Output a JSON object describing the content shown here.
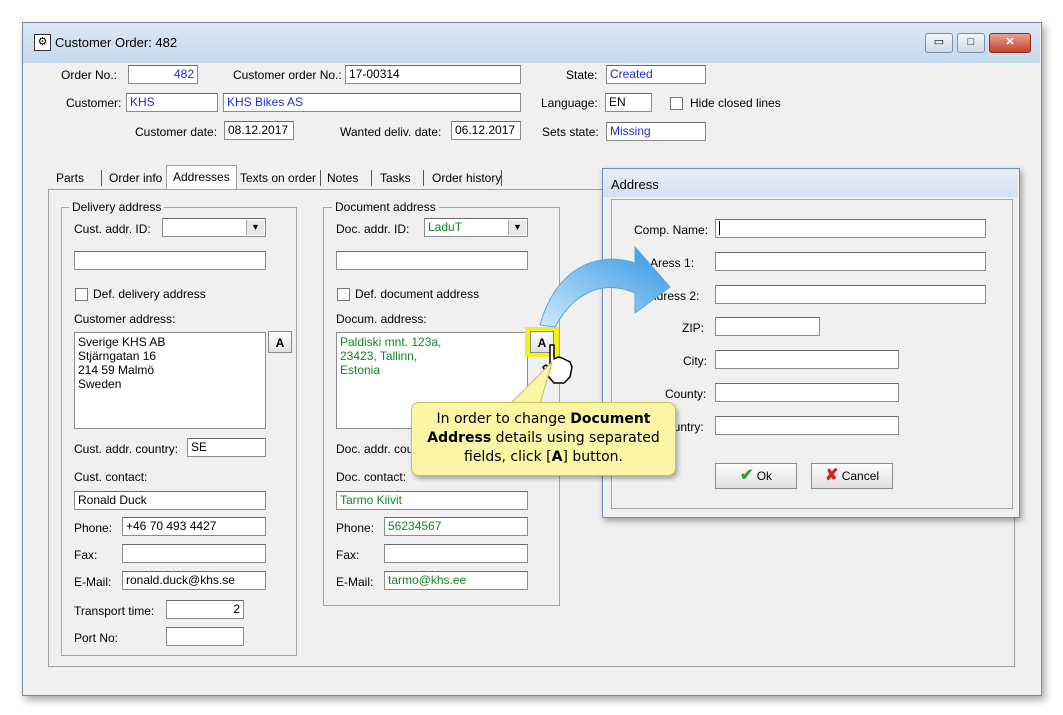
{
  "window": {
    "title": "Customer Order: 482",
    "min_label": "▭",
    "max_label": "□",
    "close_label": "✕"
  },
  "header": {
    "order_no_label": "Order No.:",
    "order_no_value": "482",
    "customer_order_no_label": "Customer order No.:",
    "customer_order_no_value": "17-00314",
    "state_label": "State:",
    "state_value": "Created",
    "customer_label": "Customer:",
    "customer_code": "KHS",
    "customer_name": "KHS Bikes AS",
    "language_label": "Language:",
    "language_value": "EN",
    "hide_closed_label": "Hide closed lines",
    "customer_date_label": "Customer date:",
    "customer_date_value": "08.12.2017",
    "wanted_date_label": "Wanted deliv. date:",
    "wanted_date_value": "06.12.2017",
    "sets_state_label": "Sets state:",
    "sets_state_value": "Missing"
  },
  "tabs": [
    "Parts",
    "Order info",
    "Addresses",
    "Texts on order",
    "Notes",
    "Tasks",
    "Order history"
  ],
  "delivery": {
    "group_title": "Delivery address",
    "addr_id_label": "Cust. addr. ID:",
    "addr_id_value": "",
    "def_label": "Def. delivery address",
    "address_label": "Customer address:",
    "address_lines": [
      "Sverige KHS AB",
      "Stjärngatan 16",
      "214 59 Malmö",
      "Sweden"
    ],
    "country_label": "Cust. addr. country:",
    "country_value": "SE",
    "contact_label": "Cust. contact:",
    "contact_value": "Ronald Duck",
    "phone_label": "Phone:",
    "phone_value": "+46 70 493 4427",
    "fax_label": "Fax:",
    "fax_value": "",
    "email_label": "E-Mail:",
    "email_value": "ronald.duck@khs.se",
    "transport_label": "Transport time:",
    "transport_value": "2",
    "port_label": "Port No:",
    "port_value": "",
    "a_button": "A"
  },
  "document": {
    "group_title": "Document address",
    "addr_id_label": "Doc. addr. ID:",
    "addr_id_value": "LaduT",
    "def_label": "Def. document address",
    "address_label": "Docum. address:",
    "address_lines": [
      "Paldiski mnt. 123a,",
      "23423, Tallinn,",
      "Estonia"
    ],
    "country_label": "Doc. addr. cou",
    "contact_label": "Doc. contact:",
    "contact_value": "Tarmo Kiivit",
    "phone_label": "Phone:",
    "phone_value": "56234567",
    "fax_label": "Fax:",
    "fax_value": "",
    "email_label": "E-Mail:",
    "email_value": "tarmo@khs.ee",
    "a_button": "A"
  },
  "dialog": {
    "title": "Address",
    "comp_name_label": "Comp. Name:",
    "address1_label": "ress 1:",
    "address1_prefix": "A",
    "address2_label": "ldress 2:",
    "zip_label": "ZIP:",
    "city_label": "City:",
    "county_label": "County:",
    "country_label": "ountry:",
    "ok_label": "Ok",
    "cancel_label": "Cancel"
  },
  "callout": {
    "part1": "In order to change ",
    "bold1": "Document Address",
    "part2": " details using separated fields, click [",
    "bold2": "A",
    "part3": "] button."
  },
  "colors": {
    "highlight": "#f2f21a",
    "arrow": "#3aa0e8",
    "ok_check": "#2aa02a",
    "cancel_x": "#d42020"
  }
}
